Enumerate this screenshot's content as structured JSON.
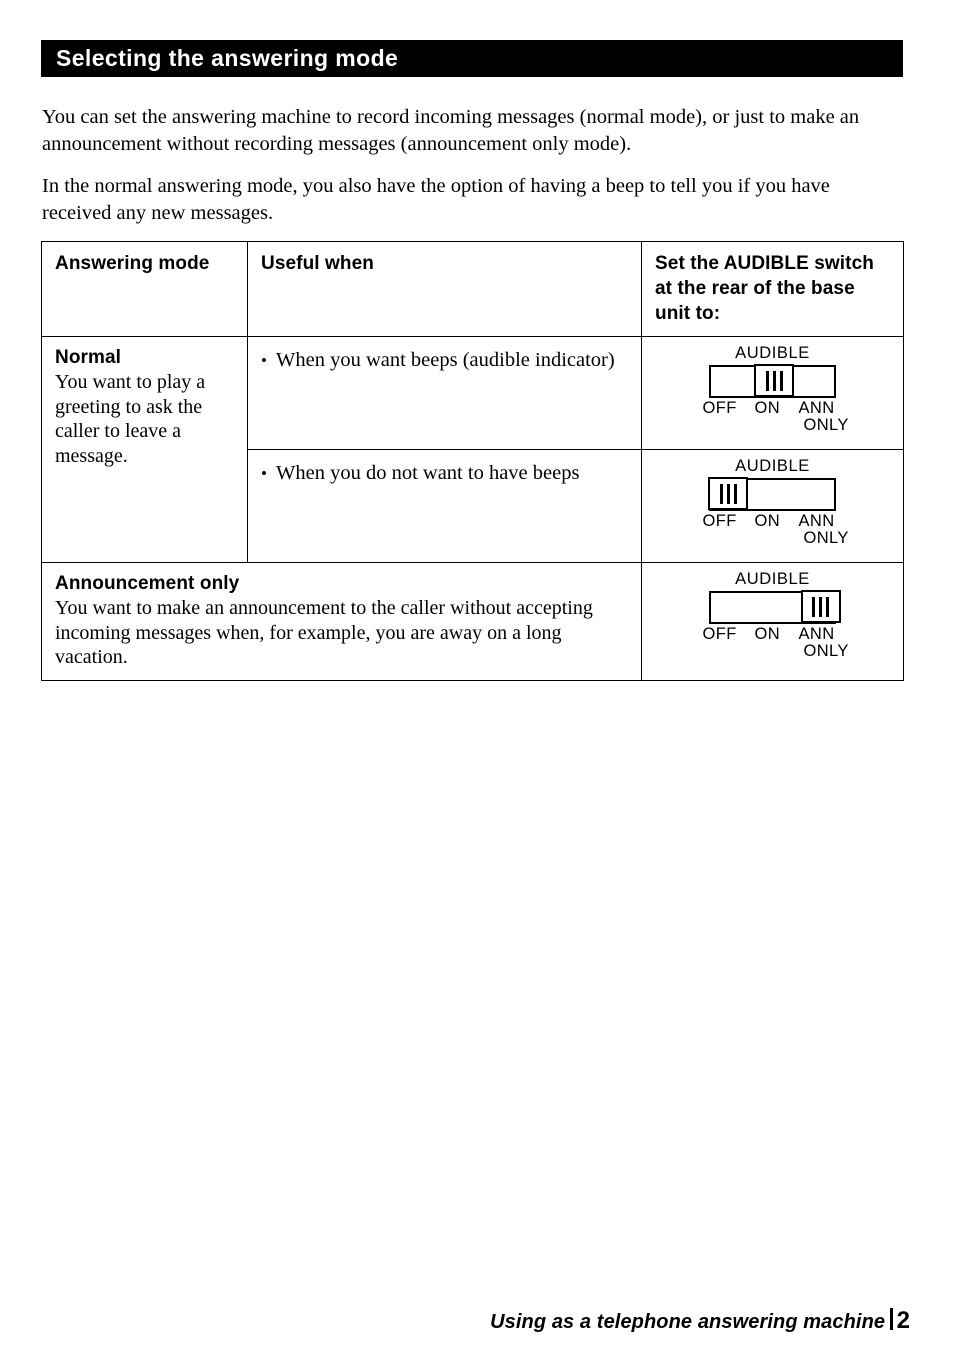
{
  "header": {
    "title": "Selecting the answering mode"
  },
  "intro": {
    "paragraph_1": "You can set the answering machine to record incoming messages (normal mode), or just to make an announcement without recording messages (announcement only mode).",
    "paragraph_2": "In the normal answering mode, you also have the option of having a beep to tell you if you have received any new messages."
  },
  "table": {
    "headers": {
      "col1": "Answering mode",
      "col2": "Useful when",
      "col3": "Set the AUDIBLE switch at the rear of the base unit to:"
    },
    "rows": [
      {
        "mode_title": "Normal",
        "mode_desc": "You want to play a greeting to ask the caller to leave a message.",
        "useful_when": "When you want  beeps (audible indicator)",
        "bullet": "•",
        "switch": {
          "label": "AUDIBLE",
          "position": "on",
          "ticks": {
            "off": "OFF",
            "on": "ON",
            "ann": "ANN",
            "only": "ONLY"
          }
        }
      },
      {
        "useful_when": "When you do not want to have beeps",
        "bullet": "•",
        "switch": {
          "label": "AUDIBLE",
          "position": "off",
          "ticks": {
            "off": "OFF",
            "on": "ON",
            "ann": "ANN",
            "only": "ONLY"
          }
        }
      },
      {
        "mode_title": "Announcement only",
        "mode_desc": "You want to make an announcement to the caller without accepting incoming messages when, for example, you are away on a long vacation.",
        "switch": {
          "label": "AUDIBLE",
          "position": "ann",
          "ticks": {
            "off": "OFF",
            "on": "ON",
            "ann": "ANN",
            "only": "ONLY"
          }
        }
      }
    ]
  },
  "footer": {
    "section": "Using as a telephone answering machine",
    "page_number": "2"
  },
  "colors": {
    "ink": "#000000",
    "paper": "#ffffff"
  }
}
